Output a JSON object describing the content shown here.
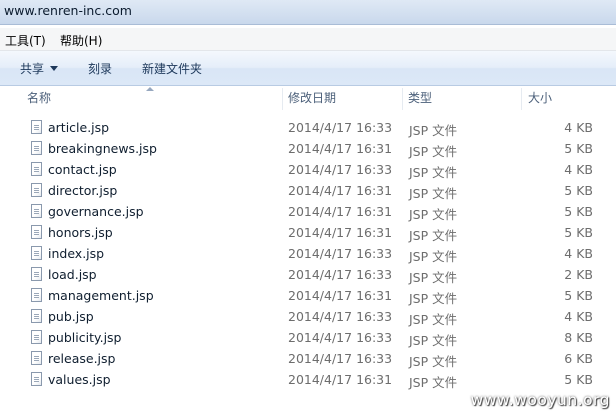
{
  "address_bar": {
    "url": "www.renren-inc.com"
  },
  "menu": {
    "items": [
      "工具(T)",
      "帮助(H)"
    ]
  },
  "toolbar": {
    "share_label": "共享",
    "burn_label": "刻录",
    "new_folder_label": "新建文件夹"
  },
  "columns": {
    "name": "名称",
    "date": "修改日期",
    "type": "类型",
    "size": "大小"
  },
  "files": [
    {
      "name": "article.jsp",
      "date": "2014/4/17 16:33",
      "type": "JSP 文件",
      "size": "4 KB"
    },
    {
      "name": "breakingnews.jsp",
      "date": "2014/4/17 16:31",
      "type": "JSP 文件",
      "size": "5 KB"
    },
    {
      "name": "contact.jsp",
      "date": "2014/4/17 16:33",
      "type": "JSP 文件",
      "size": "4 KB"
    },
    {
      "name": "director.jsp",
      "date": "2014/4/17 16:31",
      "type": "JSP 文件",
      "size": "5 KB"
    },
    {
      "name": "governance.jsp",
      "date": "2014/4/17 16:31",
      "type": "JSP 文件",
      "size": "5 KB"
    },
    {
      "name": "honors.jsp",
      "date": "2014/4/17 16:31",
      "type": "JSP 文件",
      "size": "5 KB"
    },
    {
      "name": "index.jsp",
      "date": "2014/4/17 16:33",
      "type": "JSP 文件",
      "size": "4 KB"
    },
    {
      "name": "load.jsp",
      "date": "2014/4/17 16:33",
      "type": "JSP 文件",
      "size": "2 KB"
    },
    {
      "name": "management.jsp",
      "date": "2014/4/17 16:31",
      "type": "JSP 文件",
      "size": "5 KB"
    },
    {
      "name": "pub.jsp",
      "date": "2014/4/17 16:33",
      "type": "JSP 文件",
      "size": "4 KB"
    },
    {
      "name": "publicity.jsp",
      "date": "2014/4/17 16:33",
      "type": "JSP 文件",
      "size": "8 KB"
    },
    {
      "name": "release.jsp",
      "date": "2014/4/17 16:33",
      "type": "JSP 文件",
      "size": "6 KB"
    },
    {
      "name": "values.jsp",
      "date": "2014/4/17 16:31",
      "type": "JSP 文件",
      "size": "5 KB"
    }
  ],
  "watermark": "www.wooyun.org"
}
